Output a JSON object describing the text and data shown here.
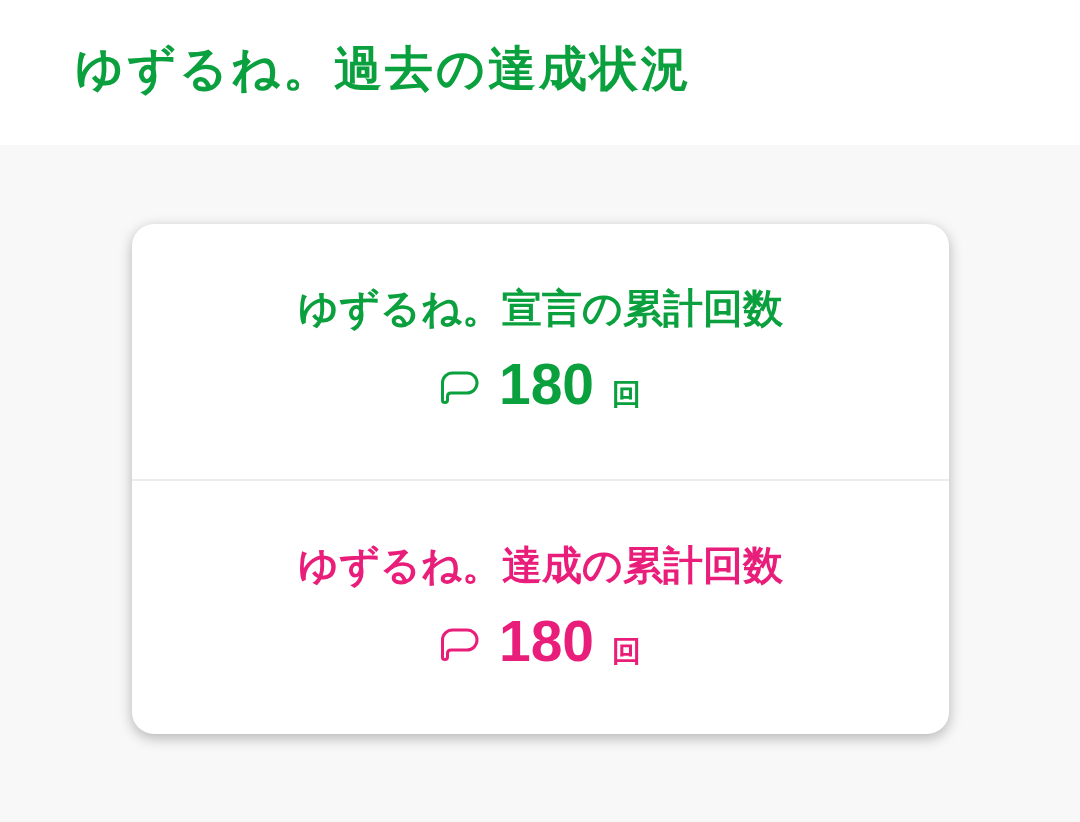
{
  "header": {
    "title": "ゆずるね。過去の達成状況"
  },
  "stats": [
    {
      "label": "ゆずるね。宣言の累計回数",
      "count": "180",
      "unit": "回",
      "color": "#0ba03e"
    },
    {
      "label": "ゆずるね。達成の累計回数",
      "count": "180",
      "unit": "回",
      "color": "#e91e7a"
    }
  ]
}
